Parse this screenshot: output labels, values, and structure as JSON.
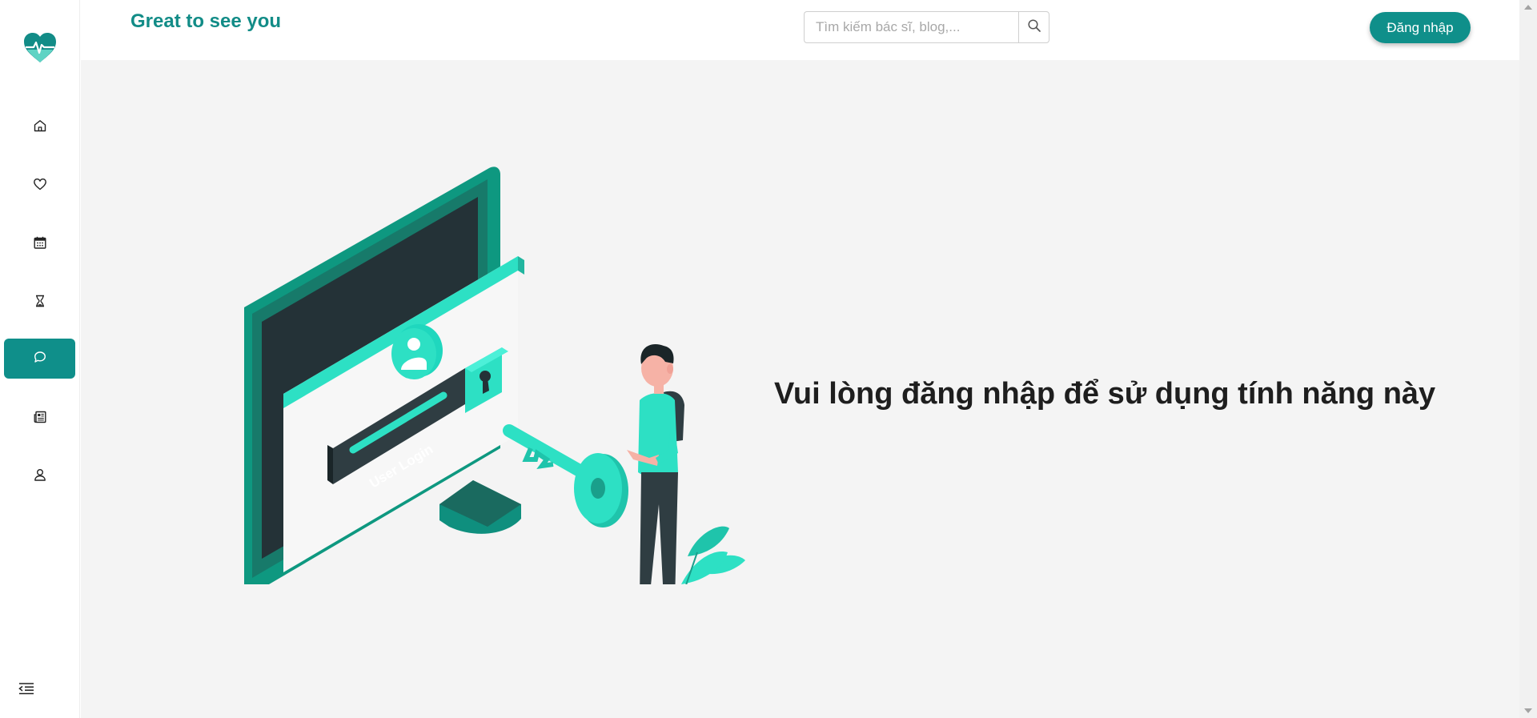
{
  "header": {
    "greeting": "Great to see you",
    "search_placeholder": "Tìm kiếm bác sĩ, blog,...",
    "login_label": "Đăng nhập"
  },
  "sidebar": {
    "items": [
      {
        "icon": "home-icon",
        "active": false
      },
      {
        "icon": "heart-icon",
        "active": false
      },
      {
        "icon": "calendar-icon",
        "active": false
      },
      {
        "icon": "hourglass-icon",
        "active": false
      },
      {
        "icon": "chat-icon",
        "active": true
      },
      {
        "icon": "news-icon",
        "active": false
      },
      {
        "icon": "user-icon",
        "active": false
      }
    ]
  },
  "main": {
    "illustration_label": "User Login",
    "message": "Vui lòng đăng nhập để sử dụng tính năng này"
  },
  "colors": {
    "brand": "#0f8f8a",
    "accent": "#1fe0c6",
    "background": "#f4f4f4"
  }
}
